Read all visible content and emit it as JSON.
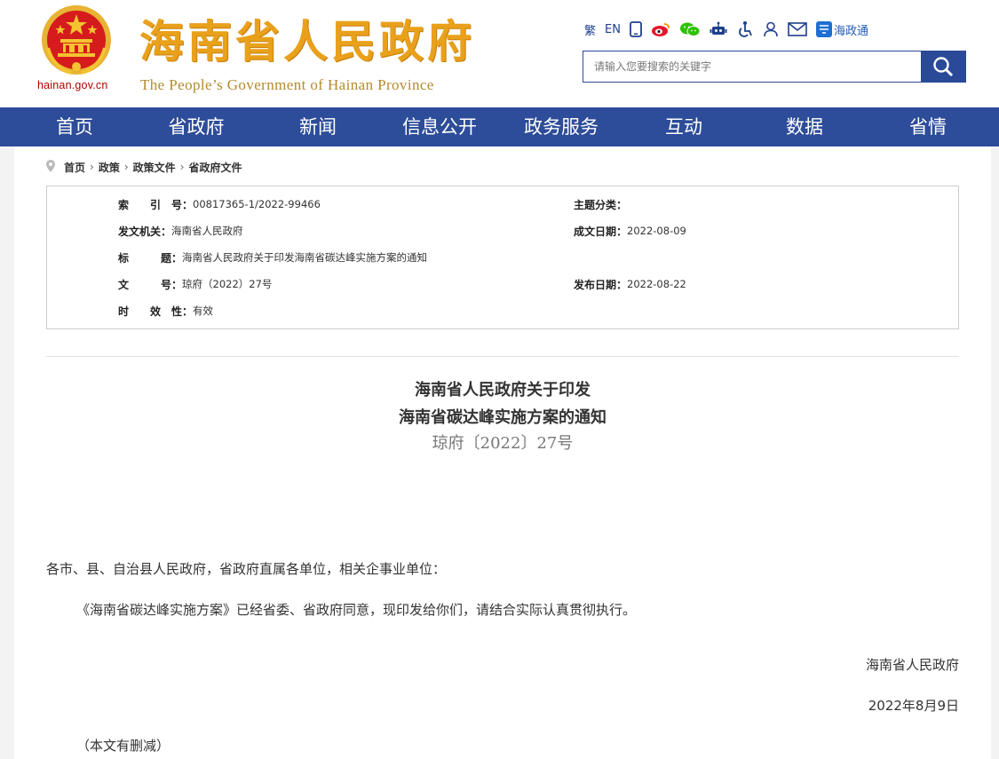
{
  "header": {
    "domain": "hainan.gov.cn",
    "title": "海南省人民政府",
    "subtitle": "The People’s Government  of Hainan Province",
    "toolbar": [
      {
        "name": "traditional-chinese",
        "label": "繁"
      },
      {
        "name": "english",
        "label": "EN"
      },
      {
        "name": "mobile-icon"
      },
      {
        "name": "weibo-icon"
      },
      {
        "name": "wechat-icon"
      },
      {
        "name": "robot-icon"
      },
      {
        "name": "accessibility-icon"
      },
      {
        "name": "user-icon"
      },
      {
        "name": "mail-icon"
      }
    ],
    "hzt_label": "海政通",
    "search_placeholder": "请输入您要搜索的关键字"
  },
  "nav": [
    "首页",
    "省政府",
    "新闻",
    "信息公开",
    "政务服务",
    "互动",
    "数据",
    "省情"
  ],
  "breadcrumb": [
    "首页",
    "政策",
    "政策文件",
    "省政府文件"
  ],
  "meta": {
    "index_key": "索　　引　号：",
    "index_value": "00817365-1/2022-99466",
    "topic_key": "主题分类：",
    "topic_value": "",
    "issuer_key": "发文机关：",
    "issuer_value": "海南省人民政府",
    "date_key": "成文日期：",
    "date_value": "2022-08-09",
    "title_key": "标　　　题：",
    "title_value": "海南省人民政府关于印发海南省碳达峰实施方案的通知",
    "docno_key": "文　　　号：",
    "docno_value": "琼府（2022）27号",
    "pubdate_key": "发布日期：",
    "pubdate_value": "2022-08-22",
    "validity_key": "时　　效　性：",
    "validity_value": "有效"
  },
  "document": {
    "title_line1": "海南省人民政府关于印发",
    "title_line2": "海南省碳达峰实施方案的通知",
    "number": "琼府〔2022〕27号",
    "salutation": "各市、县、自治县人民政府，省政府直属各单位，相关企事业单位：",
    "paragraph": "《海南省碳达峰实施方案》已经省委、省政府同意，现印发给你们，请结合实际认真贯彻执行。",
    "signer": "海南省人民政府",
    "sign_date": "2022年8月9日",
    "note": "（本文有删减）"
  },
  "colors": {
    "nav_bg": "#2d4c99",
    "title_gold": "#e9a11b",
    "emblem_red": "#d51b1b"
  }
}
